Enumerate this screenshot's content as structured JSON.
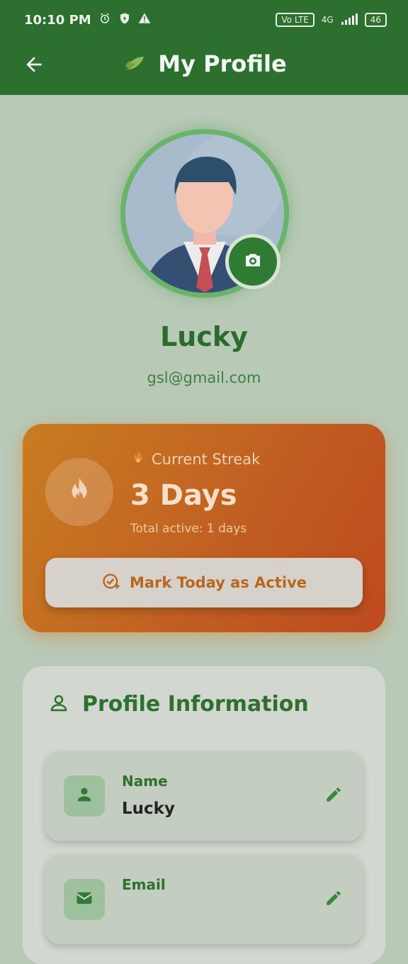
{
  "status_bar": {
    "time": "10:10 PM",
    "network": "4G",
    "volte": "Vo LTE",
    "battery": "46"
  },
  "app_bar": {
    "title": "My Profile",
    "back_icon": "arrow-left-icon",
    "leaf_icon": "leaf-icon"
  },
  "profile": {
    "name": "Lucky",
    "email": "gsl@gmail.com",
    "camera_icon": "camera-icon"
  },
  "streak": {
    "label": "Current Streak",
    "days": "3 Days",
    "total": "Total active: 1 days",
    "button_label": "Mark Today as Active",
    "flame_icon": "fire-icon"
  },
  "profile_info": {
    "title": "Profile Information",
    "fields": [
      {
        "label": "Name",
        "value": "Lucky",
        "icon": "person-icon"
      },
      {
        "label": "Email",
        "value": "",
        "icon": "mail-icon"
      }
    ]
  },
  "colors": {
    "primary": "#2d6f2f",
    "accent": "#c97d21",
    "background": "#b9c9b8"
  }
}
